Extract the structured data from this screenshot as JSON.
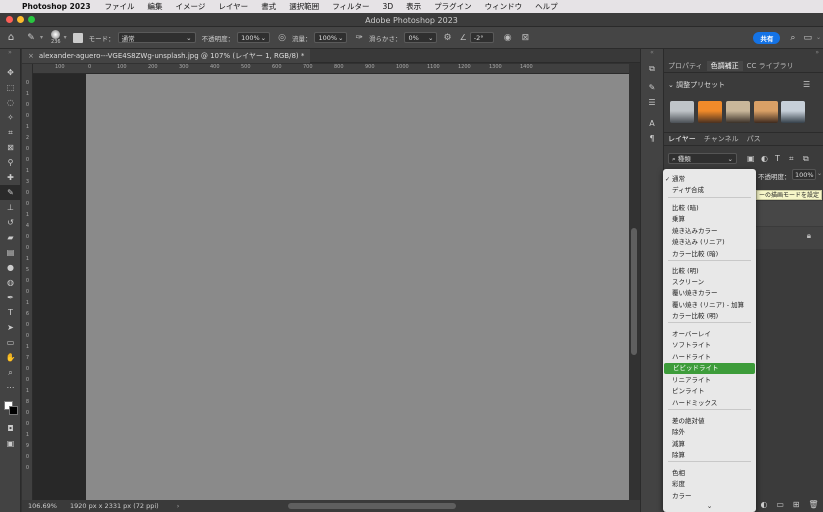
{
  "menubar": {
    "app_name": "Photoshop 2023",
    "items": [
      "ファイル",
      "編集",
      "イメージ",
      "レイヤー",
      "書式",
      "選択範囲",
      "フィルター",
      "3D",
      "表示",
      "プラグイン",
      "ウィンドウ",
      "ヘルプ"
    ]
  },
  "window": {
    "title": "Adobe Photoshop 2023"
  },
  "options": {
    "brush_size": "236",
    "mode_label": "モード：",
    "mode_value": "通常",
    "opacity_label": "不透明度：",
    "opacity_value": "100%",
    "flow_label": "流量：",
    "flow_value": "100%",
    "smoothing_label": "滑らかさ：",
    "smoothing_value": "0%",
    "angle_value": "-2°",
    "share_label": "共有"
  },
  "document": {
    "tab_title": "alexander-aguero---VGE4S8ZWg-unsplash.jpg @ 107% (レイヤー 1, RGB/8) *",
    "ruler_h": [
      "100",
      "0",
      "100",
      "200",
      "300",
      "400",
      "500",
      "600",
      "700",
      "800",
      "900",
      "1000",
      "1100",
      "1200",
      "1300",
      "1400"
    ],
    "ruler_v": [
      "0",
      "1",
      "0",
      "0",
      "1",
      "2",
      "0",
      "0",
      "1",
      "3",
      "0",
      "0",
      "1",
      "4",
      "0",
      "0",
      "1",
      "5",
      "0",
      "0",
      "1",
      "6",
      "0",
      "0",
      "1",
      "7",
      "0",
      "0",
      "1",
      "8",
      "0",
      "0",
      "1",
      "9",
      "0",
      "0"
    ]
  },
  "status": {
    "zoom": "106.69%",
    "doc_info": "1920 px x 2331 px (72 ppi)"
  },
  "panel_top": {
    "tabs": [
      "プロパティ",
      "色調補正",
      "CC ライブラリ"
    ],
    "section_title": "調整プリセット"
  },
  "layers_panel": {
    "tabs": [
      "レイヤー",
      "チャンネル",
      "パス"
    ],
    "filter_label": "種類",
    "opacity_label": "不透明度：",
    "opacity_value": "100%",
    "tooltip": "ーの描画モードを設定"
  },
  "blend_menu": {
    "groups": [
      [
        "通常",
        "ディザ合成"
      ],
      [
        "比較 (暗)",
        "乗算",
        "焼き込みカラー",
        "焼き込み (リニア)",
        "カラー比較 (暗)"
      ],
      [
        "比較 (明)",
        "スクリーン",
        "覆い焼きカラー",
        "覆い焼き (リニア) - 加算",
        "カラー比較 (明)"
      ],
      [
        "オーバーレイ",
        "ソフトライト",
        "ハードライト",
        "ビビッドライト",
        "リニアライト",
        "ピンライト",
        "ハードミックス"
      ],
      [
        "差の絶対値",
        "除外",
        "減算",
        "除算"
      ],
      [
        "色相",
        "彩度",
        "カラー"
      ]
    ],
    "checked": "通常",
    "highlighted": "ビビッドライト"
  },
  "colors": {
    "accent": "#1473e6",
    "highlight": "#3d9c3a",
    "canvas": "#8a8a8a"
  }
}
